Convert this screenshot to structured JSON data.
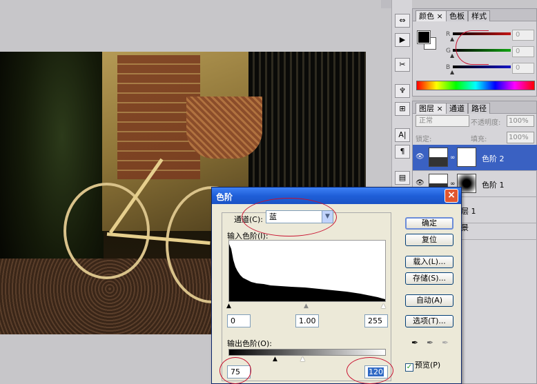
{
  "toolbar_strip": {
    "collapse_label": "◂◂",
    "tools": [
      "⇔",
      "▶",
      "✂",
      "♆",
      "⊞",
      "A|",
      "¶",
      "▤",
      "⊡"
    ]
  },
  "color_panel": {
    "tabs": [
      "颜色",
      "色板",
      "样式"
    ],
    "close_glyph": "×",
    "channels": [
      {
        "label": "R",
        "value": "0",
        "color": "#c41414"
      },
      {
        "label": "G",
        "value": "0",
        "color": "#12a412"
      },
      {
        "label": "B",
        "value": "0",
        "color": "#1414c4"
      }
    ]
  },
  "layers_panel": {
    "tabs": [
      "图层",
      "通道",
      "路径"
    ],
    "close_glyph": "×",
    "blend_mode": "正常",
    "opacity_label": "不透明度:",
    "opacity_value": "100%",
    "lock_label": "锁定:",
    "fill_label": "填充:",
    "fill_value": "100%",
    "layers": [
      {
        "name": "色阶 2",
        "selected": true
      },
      {
        "name": "色阶 1",
        "selected": false
      },
      {
        "name": "层 1",
        "selected": false
      },
      {
        "name": "景",
        "selected": false
      }
    ]
  },
  "levels_dialog": {
    "title": "色阶",
    "close_glyph": "×",
    "channel_label": "通道(C):",
    "channel_value": "蓝",
    "input_label": "输入色阶(I):",
    "input_black": "0",
    "input_gamma": "1.00",
    "input_white": "255",
    "output_label": "输出色阶(O):",
    "output_black": "75",
    "output_white": "120",
    "buttons": {
      "ok": "确定",
      "reset": "复位",
      "load": "载入(L)...",
      "save": "存储(S)...",
      "auto": "自动(A)",
      "options": "选项(T)..."
    },
    "preview_label": "预览(P)",
    "preview_checked": true,
    "picker_icons": [
      "black-eyedropper-icon",
      "gray-eyedropper-icon",
      "white-eyedropper-icon"
    ]
  },
  "colors": {
    "highlight": "#316ac5",
    "annotation": "#c8102e",
    "titlebar": "#1f5fd8"
  }
}
